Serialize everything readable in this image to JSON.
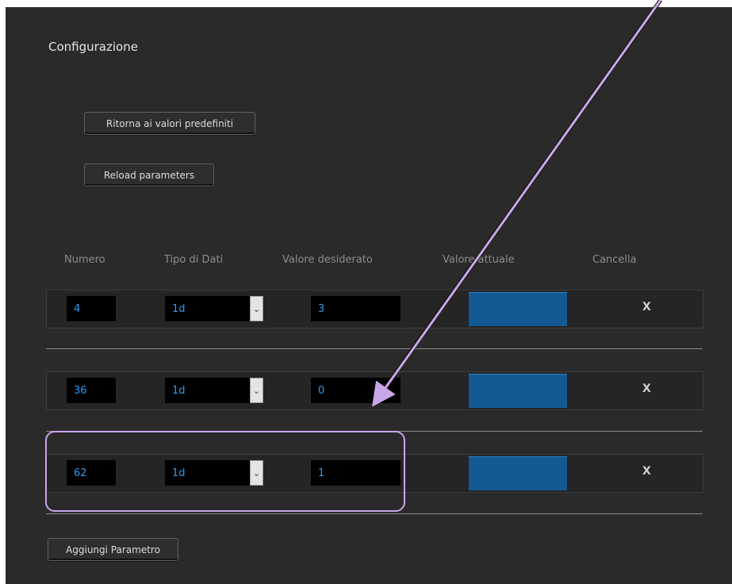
{
  "page": {
    "title": "Configurazione"
  },
  "buttons": {
    "reset": "Ritorna ai valori predefiniti",
    "reload": "Reload parameters",
    "add": "Aggiungi Parametro"
  },
  "table": {
    "columns": [
      "Numero",
      "Tipo di Dati",
      "Valore desiderato",
      "Valore attuale",
      "Cancella"
    ],
    "rows": [
      {
        "numero": "4",
        "tipo": "1d",
        "valore": "3",
        "cancella": "X"
      },
      {
        "numero": "36",
        "tipo": "1d",
        "valore": "0",
        "cancella": "X"
      },
      {
        "numero": "62",
        "tipo": "1d",
        "valore": "1",
        "cancella": "X"
      }
    ]
  },
  "colors": {
    "panel": "#2a2a2a",
    "field_text": "#2f9af0",
    "actual_value": "#135a94",
    "annotation": "#c9a6ea"
  },
  "icons": {
    "dropdown": "chevron-down-icon",
    "annotation": "arrow-icon"
  }
}
